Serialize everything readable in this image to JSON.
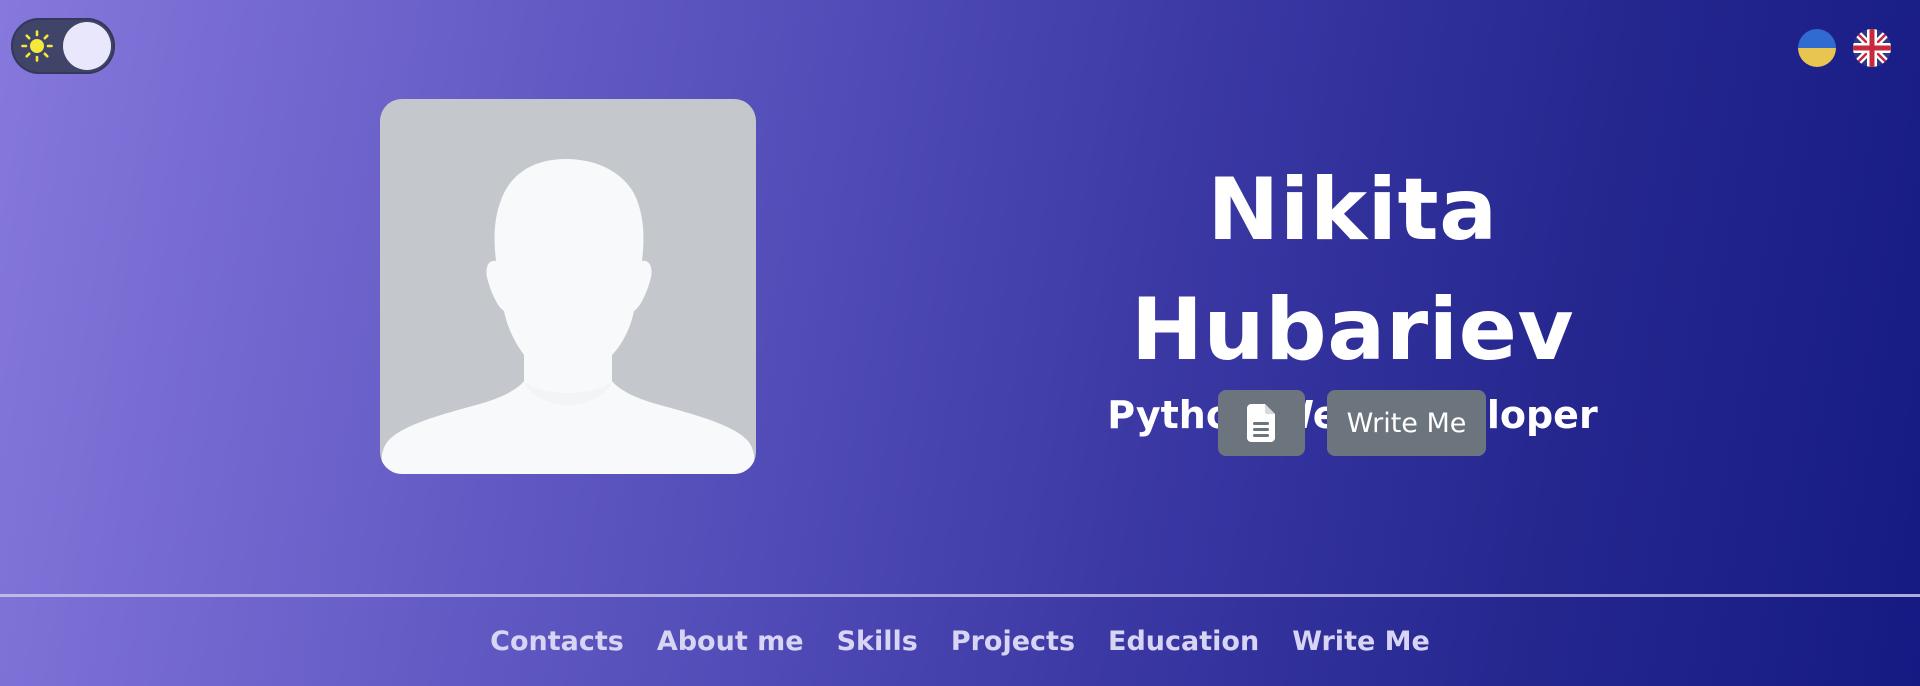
{
  "profile": {
    "name": "Nikita Hubariev",
    "role": "Python Web Developer"
  },
  "actions": {
    "cv_icon": "document-icon",
    "write_label": "Write Me"
  },
  "theme_toggle": {
    "icon": "sun-icon",
    "state": "light"
  },
  "languages": [
    {
      "icon": "ukraine-flag-icon"
    },
    {
      "icon": "uk-flag-icon"
    }
  ],
  "nav": {
    "items": [
      {
        "label": "Contacts"
      },
      {
        "label": "About me"
      },
      {
        "label": "Skills"
      },
      {
        "label": "Projects"
      },
      {
        "label": "Education"
      },
      {
        "label": "Write Me"
      }
    ]
  },
  "colors": {
    "button": "#6c757d",
    "avatar_bg": "#c4c7cc",
    "sun": "#f2e93a"
  }
}
